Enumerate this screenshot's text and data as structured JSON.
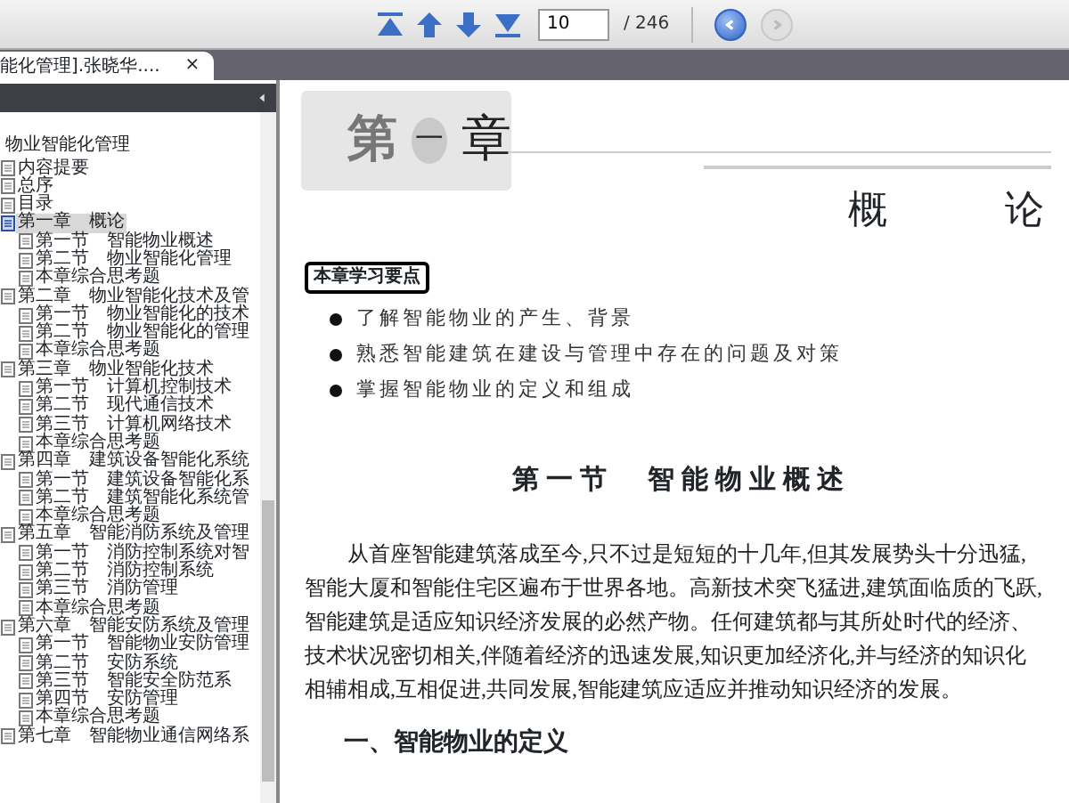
{
  "toolbar": {
    "page_input": "10",
    "page_total": "/ 246",
    "back_enabled": true,
    "forward_enabled": false
  },
  "tab": {
    "title": "能化管理].张晓华....",
    "close": "×"
  },
  "sidebar": {
    "title": "物业智能化管理",
    "tree": [
      {
        "label": "内容提要",
        "selected": false
      },
      {
        "label": "总序",
        "selected": false
      },
      {
        "label": "目录",
        "selected": false
      },
      {
        "label": "第一章　概论",
        "selected": true,
        "children": [
          {
            "label": "第一节　智能物业概述",
            "selected": false
          },
          {
            "label": "第二节　物业智能化管理",
            "selected": false
          },
          {
            "label": "本章综合思考题",
            "selected": false
          }
        ]
      },
      {
        "label": "第二章　物业智能化技术及管",
        "selected": false,
        "children": [
          {
            "label": "第一节　物业智能化的技术",
            "selected": false
          },
          {
            "label": "第二节　物业智能化的管理",
            "selected": false
          },
          {
            "label": "本章综合思考题",
            "selected": false
          }
        ]
      },
      {
        "label": "第三章　物业智能化技术",
        "selected": false,
        "children": [
          {
            "label": "第一节　计算机控制技术",
            "selected": false
          },
          {
            "label": "第二节　现代通信技术",
            "selected": false
          },
          {
            "label": "第三节　计算机网络技术",
            "selected": false
          },
          {
            "label": "本章综合思考题",
            "selected": false
          }
        ]
      },
      {
        "label": "第四章　建筑设备智能化系统",
        "selected": false,
        "children": [
          {
            "label": "第一节　建筑设备智能化系",
            "selected": false
          },
          {
            "label": "第二节　建筑智能化系统管",
            "selected": false
          },
          {
            "label": "本章综合思考题",
            "selected": false
          }
        ]
      },
      {
        "label": "第五章　智能消防系统及管理",
        "selected": false,
        "children": [
          {
            "label": "第一节　消防控制系统对智",
            "selected": false
          },
          {
            "label": "第二节　消防控制系统",
            "selected": false
          },
          {
            "label": "第三节　消防管理",
            "selected": false
          },
          {
            "label": "本章综合思考题",
            "selected": false
          }
        ]
      },
      {
        "label": "第六章　智能安防系统及管理",
        "selected": false,
        "children": [
          {
            "label": "第一节　智能物业安防管理",
            "selected": false
          },
          {
            "label": "第二节　安防系统",
            "selected": false
          },
          {
            "label": "第三节　智能安全防范系",
            "selected": false
          },
          {
            "label": "第四节　安防管理",
            "selected": false
          },
          {
            "label": "本章综合思考题",
            "selected": false
          }
        ]
      },
      {
        "label": "第七章　智能物业通信网络系",
        "selected": false
      }
    ]
  },
  "page": {
    "banner": {
      "prefix": "第",
      "number": "一",
      "suffix": "章"
    },
    "chapter_title": "概论",
    "key_points_label": "本章学习要点",
    "key_points": [
      "了解智能物业的产生、背景",
      "熟悉智能建筑在建设与管理中存在的问题及对策",
      "掌握智能物业的定义和组成"
    ],
    "section_heading": "第一节　智能物业概述",
    "paragraph": "从首座智能建筑落成至今,只不过是短短的十几年,但其发展势头十分迅猛,智能大厦和智能住宅区遍布于世界各地。高新技术突飞猛进,建筑面临质的飞跃,智能建筑是适应知识经济发展的必然产物。任何建筑都与其所处时代的经济、技术状况密切相关,伴随着经济的迅速发展,知识更加经济化,并与经济的知识化相辅相成,互相促进,共同发展,智能建筑应适应并推动知识经济的发展。",
    "subheading": "一、智能物业的定义"
  }
}
